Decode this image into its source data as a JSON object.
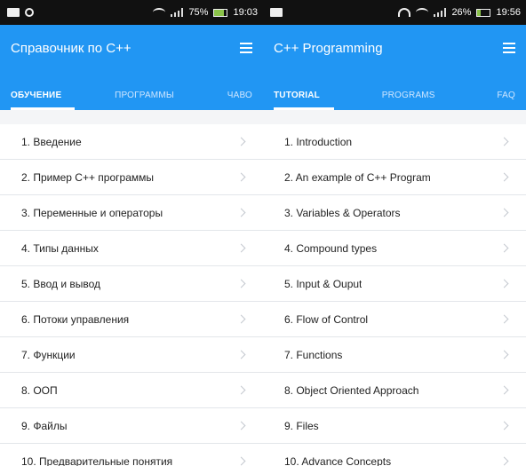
{
  "left_screen": {
    "status": {
      "battery_percent": "75%",
      "time": "19:03",
      "battery_level": 0.75
    },
    "app_title": "Справочник по C++",
    "tabs": [
      {
        "label": "ОБУЧЕНИЕ",
        "active": true
      },
      {
        "label": "ПРОГРАММЫ",
        "active": false
      },
      {
        "label": "ЧАВО",
        "active": false
      }
    ],
    "items": [
      "1. Введение",
      "2. Пример C++ программы",
      "3. Переменные и операторы",
      "4. Типы данных",
      "5. Ввод и вывод",
      "6. Потоки управления",
      "7. Функции",
      "8. ООП",
      "9. Файлы",
      "10. Предварительные понятия"
    ]
  },
  "right_screen": {
    "status": {
      "battery_percent": "26%",
      "time": "19:56",
      "battery_level": 0.26
    },
    "app_title": "C++ Programming",
    "tabs": [
      {
        "label": "TUTORIAL",
        "active": true
      },
      {
        "label": "PROGRAMS",
        "active": false
      },
      {
        "label": "FAQ",
        "active": false
      }
    ],
    "items": [
      "1. Introduction",
      "2. An example of C++ Program",
      "3. Variables & Operators",
      "4. Compound types",
      "5. Input & Ouput",
      "6. Flow of Control",
      "7. Functions",
      "8. Object Oriented Approach",
      "9. Files",
      "10. Advance Concepts"
    ]
  },
  "colors": {
    "app_bar": "#2196f3",
    "status_bar": "#111111",
    "battery": "#8bc34a"
  },
  "icons": {
    "menu": "menu-icon",
    "chevron": "chevron-right-icon",
    "wifi": "wifi-icon",
    "signal": "signal-icon",
    "battery": "battery-icon",
    "headset": "headset-icon"
  }
}
